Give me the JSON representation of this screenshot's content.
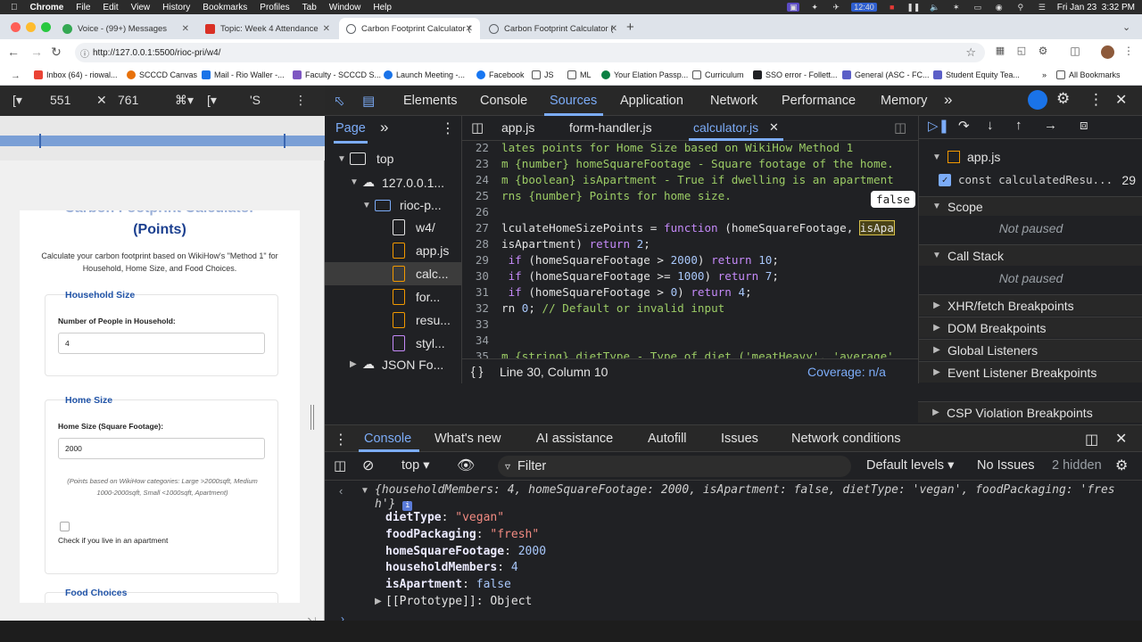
{
  "menubar": {
    "items": [
      "Chrome",
      "File",
      "Edit",
      "View",
      "History",
      "Bookmarks",
      "Profiles",
      "Tab",
      "Window",
      "Help"
    ],
    "time_small": "12:40",
    "datetime": "Fri Jan 23  3:32 PM",
    "gemini": "Gemini"
  },
  "tabs": [
    {
      "label": "Voice - (99+) Messages",
      "color": "#34a853"
    },
    {
      "label": "Topic: Week 4 Attendance",
      "color": "#d93025"
    },
    {
      "label": "Carbon Footprint Calculator (",
      "color": "#5f6368"
    },
    {
      "label": "Carbon Footprint Calculator (",
      "color": "#5f6368"
    }
  ],
  "address": {
    "url": "http://127.0.0.1:5500/rioc-pri/w4/"
  },
  "bookmarks": [
    {
      "label": "Inbox (64) - riowal...",
      "color": "#ea4335"
    },
    {
      "label": "SCCCD Canvas",
      "color": "#e8710a"
    },
    {
      "label": "Mail - Rio Waller -...",
      "color": "#1a73e8"
    },
    {
      "label": "Faculty - SCCCD S...",
      "color": "#7e57c2"
    },
    {
      "label": "Launch Meeting -...",
      "color": "#1a73e8"
    },
    {
      "label": "Facebook",
      "color": "#1877f2"
    },
    {
      "label": "JS",
      "color": "#5f6368"
    },
    {
      "label": "ML",
      "color": "#5f6368"
    },
    {
      "label": "Your Elation Passp...",
      "color": "#0b8043"
    },
    {
      "label": "Curriculum",
      "color": "#5f6368"
    },
    {
      "label": "SSO error - Follett...",
      "color": "#202124"
    },
    {
      "label": "General (ASC - FC...",
      "color": "#5b5fc7"
    },
    {
      "label": "Student Equity Tea...",
      "color": "#5b5fc7"
    }
  ],
  "all_bookmarks": "All Bookmarks",
  "device": {
    "width": "551",
    "height": "761"
  },
  "page": {
    "title": "(Points)",
    "subtitle": "Calculate your carbon footprint based on WikiHow's \"Method 1\" for Household, Home Size, and Food Choices.",
    "household": {
      "heading": "Household Size",
      "label": "Number of People in Household:",
      "value": "4"
    },
    "home": {
      "heading": "Home Size",
      "label": "Home Size (Square Footage):",
      "value": "2000",
      "note": "(Points based on WikiHow categories: Large >2000sqft, Medium 1000-2000sqft, Small <1000sqft, Apartment)",
      "checkbox_label": "Check if you live in an apartment"
    },
    "food": {
      "heading": "Food Choices"
    }
  },
  "devtools": {
    "tabs": [
      "Elements",
      "Console",
      "Sources",
      "Application",
      "Network",
      "Performance",
      "Memory"
    ],
    "active_tab": "Sources",
    "navigator": {
      "tab": "Page",
      "tree": [
        "top",
        "127.0.0.1...",
        "rioc-p...",
        "w4/",
        "app.js",
        "calc...",
        "for...",
        "resu...",
        "styl...",
        "JSON Fo..."
      ]
    },
    "editor_tabs": [
      "app.js",
      "form-handler.js",
      "calculator.js"
    ],
    "tooltip": "false",
    "status": {
      "position": "Line 30, Column 10",
      "coverage": "Coverage: n/a"
    },
    "debugger": {
      "file": "app.js",
      "breakpoint_code": "const calculatedResu...",
      "breakpoint_line": "29",
      "scope": "Scope",
      "scope_msg": "Not paused",
      "callstack": "Call Stack",
      "callstack_msg": "Not paused",
      "sections": [
        "XHR/fetch Breakpoints",
        "DOM Breakpoints",
        "Global Listeners",
        "Event Listener Breakpoints",
        "CSP Violation Breakpoints"
      ]
    }
  },
  "drawer": {
    "tabs": [
      "Console",
      "What's new",
      "AI assistance",
      "Autofill",
      "Issues",
      "Network conditions"
    ],
    "context": "top",
    "filter_placeholder": "Filter",
    "levels": "Default levels",
    "issues": "No Issues",
    "hidden": "2 hidden",
    "summary": "{householdMembers: 4, homeSquareFootage: 2000, isApartment: false, dietType: 'vegan', foodPackaging: 'fres",
    "summary_wrap": "h'}",
    "props": [
      {
        "key": "dietType",
        "value": "\"vegan\"",
        "kind": "str"
      },
      {
        "key": "foodPackaging",
        "value": "\"fresh\"",
        "kind": "str"
      },
      {
        "key": "homeSquareFootage",
        "value": "2000",
        "kind": "num"
      },
      {
        "key": "householdMembers",
        "value": "4",
        "kind": "num"
      },
      {
        "key": "isApartment",
        "value": "false",
        "kind": "num"
      }
    ],
    "prototype": "[[Prototype]]: Object"
  }
}
